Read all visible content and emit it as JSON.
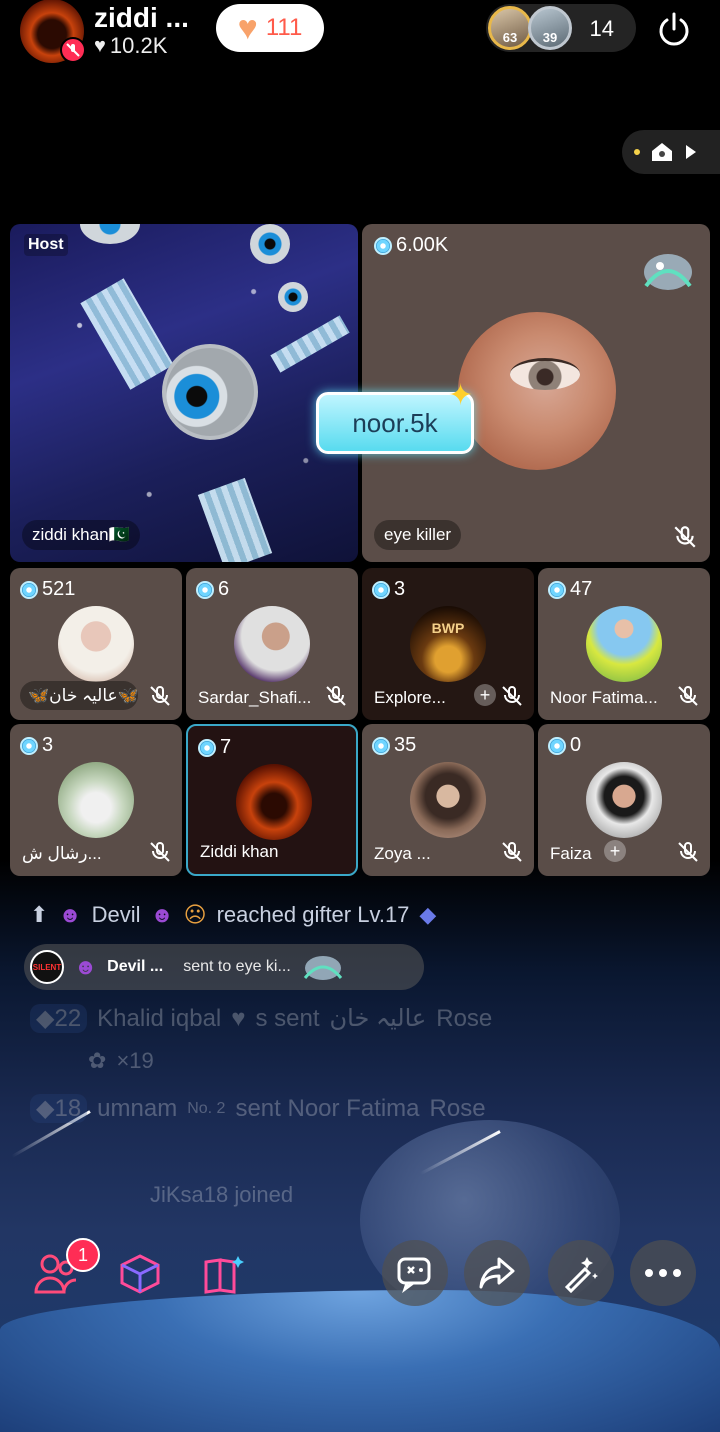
{
  "header": {
    "host_name": "ziddi ...",
    "host_likes": "10.2K",
    "like_count": "111",
    "viewers": [
      {
        "badge": "63"
      },
      {
        "badge": "39"
      }
    ],
    "viewer_count": "14"
  },
  "main_seats": {
    "host": {
      "label": "Host",
      "name": "ziddi khan🇵🇰"
    },
    "guest": {
      "coins": "6.00K",
      "name": "eye killer"
    },
    "overlay_tag": "noor.5k"
  },
  "seats": [
    {
      "coins": "521",
      "name": "🦋عالیہ خان🦋",
      "muted": true
    },
    {
      "coins": "6",
      "name": "Sardar_Shafi...",
      "muted": true
    },
    {
      "coins": "3",
      "name": "Explore...",
      "muted": true,
      "has_add": true,
      "avatar_text": "BWP"
    },
    {
      "coins": "47",
      "name": "Noor Fatima...",
      "muted": true
    },
    {
      "coins": "3",
      "name": "رشال ش...",
      "muted": true
    },
    {
      "coins": "7",
      "name": "Ziddi khan",
      "muted": false,
      "selected": true
    },
    {
      "coins": "35",
      "name": "Zoya ...",
      "muted": true
    },
    {
      "coins": "0",
      "name": "Faiza",
      "muted": true,
      "has_add": true
    }
  ],
  "chat": {
    "gifter_user": "Devil",
    "gifter_text": "reached gifter Lv.17",
    "gift_user": "Devil ...",
    "gift_text": "sent to eye ki...",
    "gift_avatar_text": "SILENT",
    "faded": [
      {
        "level": "22",
        "text": "Khalid iqbal",
        "rest": "s sent",
        "target": "عالیہ خان",
        "gift": "Rose",
        "count": "×19"
      },
      {
        "level": "18",
        "text": "umnam",
        "badge": "No. 2",
        "rest": "sent Noor Fatima",
        "gift": "Rose"
      },
      {
        "text": "JiKsa18 joined"
      }
    ]
  },
  "toolbar": {
    "notification_count": "1"
  }
}
